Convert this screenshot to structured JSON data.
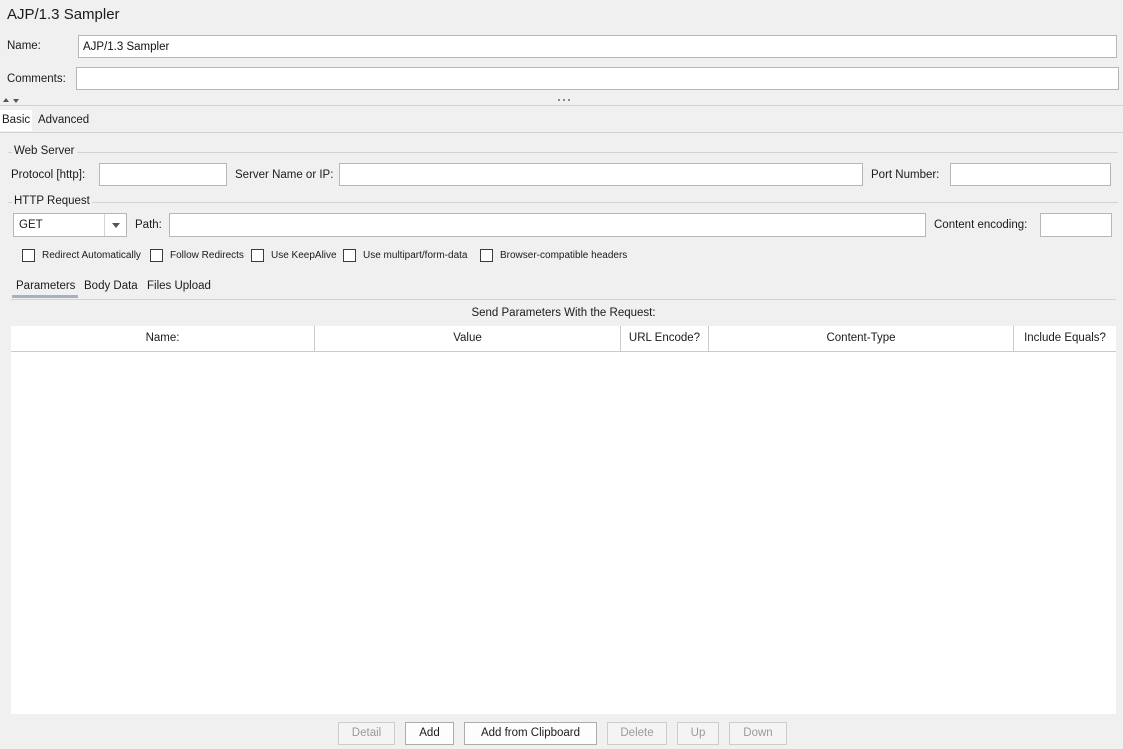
{
  "window": {
    "title": "AJP/1.3 Sampler"
  },
  "name_field": {
    "label": "Name:",
    "value": "AJP/1.3 Sampler"
  },
  "comments_field": {
    "label": "Comments:",
    "value": ""
  },
  "splitter": {
    "collapse_icon": "triangle-up-icon",
    "expand_icon": "triangle-down-icon",
    "handle_icon": "drag-dots-icon"
  },
  "tabs": [
    {
      "label": "Basic",
      "selected": true
    },
    {
      "label": "Advanced",
      "selected": false
    }
  ],
  "web_server": {
    "title": "Web Server",
    "protocol": {
      "label": "Protocol [http]:",
      "value": ""
    },
    "server": {
      "label": "Server Name or IP:",
      "value": ""
    },
    "port": {
      "label": "Port Number:",
      "value": ""
    }
  },
  "http_request": {
    "title": "HTTP Request",
    "method": {
      "value": "GET",
      "arrow_icon": "chevron-down-icon"
    },
    "path": {
      "label": "Path:",
      "value": ""
    },
    "encoding": {
      "label": "Content encoding:",
      "value": ""
    },
    "options": [
      {
        "label": "Redirect Automatically",
        "checked": false
      },
      {
        "label": "Follow Redirects",
        "checked": false
      },
      {
        "label": "Use KeepAlive",
        "checked": false
      },
      {
        "label": "Use multipart/form-data",
        "checked": false
      },
      {
        "label": "Browser-compatible headers",
        "checked": false
      }
    ]
  },
  "sub_tabs": [
    {
      "label": "Parameters",
      "selected": true
    },
    {
      "label": "Body Data",
      "selected": false
    },
    {
      "label": "Files Upload",
      "selected": false
    }
  ],
  "parameters": {
    "caption": "Send Parameters With the Request:",
    "columns": [
      "Name:",
      "Value",
      "URL Encode?",
      "Content-Type",
      "Include Equals?"
    ],
    "rows": []
  },
  "buttons": [
    {
      "label": "Detail",
      "enabled": false
    },
    {
      "label": "Add",
      "enabled": true
    },
    {
      "label": "Add from Clipboard",
      "enabled": true
    },
    {
      "label": "Delete",
      "enabled": false
    },
    {
      "label": "Up",
      "enabled": false
    },
    {
      "label": "Down",
      "enabled": false
    }
  ]
}
